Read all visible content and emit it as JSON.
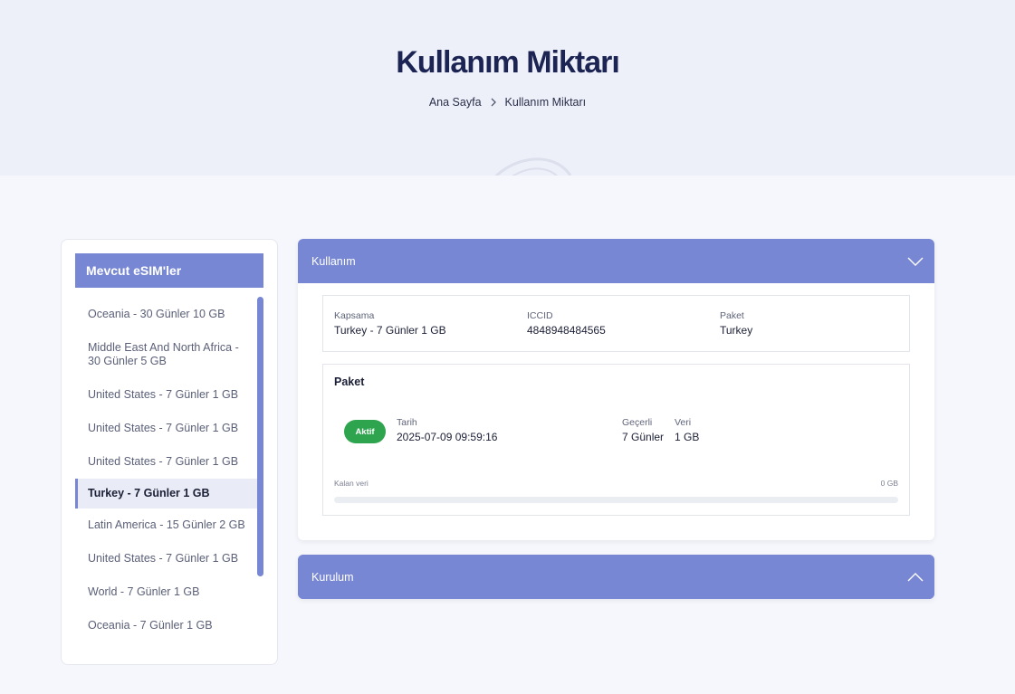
{
  "hero": {
    "title": "Kullanım Miktarı",
    "breadcrumb": [
      "Ana Sayfa",
      "Kullanım Miktarı"
    ]
  },
  "sidebar": {
    "title": "Mevcut eSIM'ler",
    "items": [
      {
        "label": "Oceania - 30 Günler 10 GB",
        "active": false
      },
      {
        "label": "Middle East And North Africa - 30 Günler 5 GB",
        "active": false
      },
      {
        "label": "United States - 7 Günler 1 GB",
        "active": false
      },
      {
        "label": "United States - 7 Günler 1 GB",
        "active": false
      },
      {
        "label": "United States - 7 Günler 1 GB",
        "active": false
      },
      {
        "label": "Turkey - 7 Günler 1 GB",
        "active": true
      },
      {
        "label": "Latin America - 15 Günler 2 GB",
        "active": false
      },
      {
        "label": "United States - 7 Günler 1 GB",
        "active": false
      },
      {
        "label": "World - 7 Günler 1 GB",
        "active": false
      },
      {
        "label": "Oceania - 7 Günler 1 GB",
        "active": false
      }
    ]
  },
  "usage": {
    "header": "Kullanım",
    "info": {
      "coverage_label": "Kapsama",
      "coverage": "Turkey - 7 Günler 1 GB",
      "iccid_label": "ICCID",
      "iccid": "4848948484565",
      "package_label": "Paket",
      "package": "Turkey"
    },
    "package": {
      "title": "Paket",
      "status": "Aktif",
      "date_label": "Tarih",
      "date": "2025-07-09 09:59:16",
      "validity_label": "Geçerli",
      "validity": "7 Günler",
      "data_label": "Veri",
      "data": "1 GB",
      "remaining_label": "Kalan veri",
      "remaining": "0 GB",
      "remaining_fraction": 0
    }
  },
  "setup": {
    "header": "Kurulum"
  },
  "colors": {
    "accent": "#7887d3",
    "active_badge": "#2ea44f",
    "hero_bg": "#eef0f9",
    "title": "#1b2452"
  }
}
